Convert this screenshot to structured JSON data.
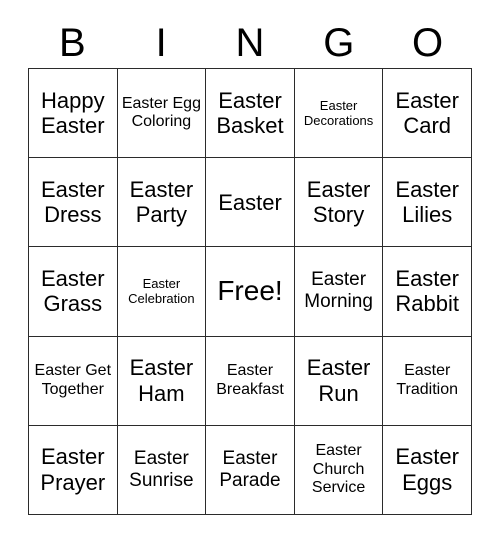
{
  "header": {
    "letters": [
      "B",
      "I",
      "N",
      "G",
      "O"
    ]
  },
  "grid": {
    "columns": 5,
    "rows": 5,
    "free_space_label": "Free!",
    "cells": [
      [
        {
          "text": "Happy Easter",
          "size": "lg"
        },
        {
          "text": "Easter Egg Coloring",
          "size": "sm"
        },
        {
          "text": "Easter Basket",
          "size": "lg"
        },
        {
          "text": "Easter Decorations",
          "size": "xs"
        },
        {
          "text": "Easter Card",
          "size": "lg"
        }
      ],
      [
        {
          "text": "Easter Dress",
          "size": "lg"
        },
        {
          "text": "Easter Party",
          "size": "lg"
        },
        {
          "text": "Easter",
          "size": "lg"
        },
        {
          "text": "Easter Story",
          "size": "lg"
        },
        {
          "text": "Easter Lilies",
          "size": "lg"
        }
      ],
      [
        {
          "text": "Easter Grass",
          "size": "lg"
        },
        {
          "text": "Easter Celebration",
          "size": "xs"
        },
        {
          "text": "Free!",
          "size": "xl"
        },
        {
          "text": "Easter Morning",
          "size": "md"
        },
        {
          "text": "Easter Rabbit",
          "size": "lg"
        }
      ],
      [
        {
          "text": "Easter Get Together",
          "size": "sm"
        },
        {
          "text": "Easter Ham",
          "size": "lg"
        },
        {
          "text": "Easter Breakfast",
          "size": "sm"
        },
        {
          "text": "Easter Run",
          "size": "lg"
        },
        {
          "text": "Easter Tradition",
          "size": "sm"
        }
      ],
      [
        {
          "text": "Easter Prayer",
          "size": "lg"
        },
        {
          "text": "Easter Sunrise",
          "size": "md"
        },
        {
          "text": "Easter Parade",
          "size": "md"
        },
        {
          "text": "Easter Church Service",
          "size": "sm"
        },
        {
          "text": "Easter Eggs",
          "size": "lg"
        }
      ]
    ]
  },
  "colors": {
    "background": "#ffffff",
    "text": "#000000",
    "grid_line": "#2b2b2b"
  }
}
